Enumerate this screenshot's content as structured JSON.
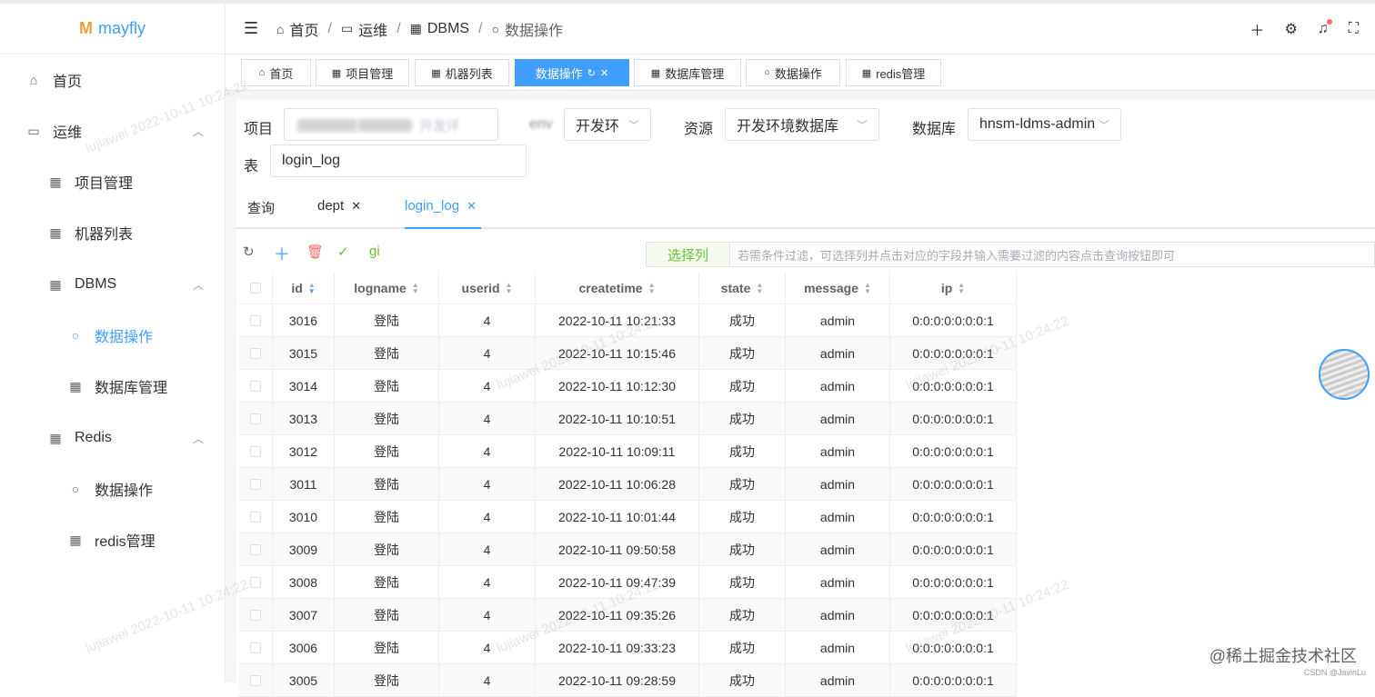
{
  "app": {
    "logo": "mayfly"
  },
  "sidebar": {
    "items": [
      {
        "label": "首页",
        "icon": "home-icon"
      },
      {
        "label": "运维",
        "icon": "monitor-icon"
      },
      {
        "label": "项目管理",
        "icon": "grid-icon"
      },
      {
        "label": "机器列表",
        "icon": "grid-icon"
      },
      {
        "label": "DBMS",
        "icon": "grid-icon"
      },
      {
        "label": "数据操作",
        "icon": "search-icon"
      },
      {
        "label": "数据库管理",
        "icon": "grid-icon"
      },
      {
        "label": "Redis",
        "icon": "grid-icon"
      },
      {
        "label": "数据操作",
        "icon": "search-icon"
      },
      {
        "label": "redis管理",
        "icon": "grid-icon"
      }
    ]
  },
  "header": {
    "breadcrumbs": [
      "首页",
      "运维",
      "DBMS",
      "数据操作"
    ]
  },
  "tags": [
    "首页",
    "项目管理",
    "机器列表",
    "数据操作",
    "数据库管理",
    "数据操作",
    "redis管理"
  ],
  "form": {
    "project_label": "项目",
    "project_value_tail": "开发环",
    "env_label": "env",
    "env_value": "开发环",
    "resource_label": "资源",
    "resource_value": "开发环境数据库",
    "db_label": "数据库",
    "db_value": "hnsm-ldms-admin",
    "table_label": "表",
    "table_value": "login_log"
  },
  "query_tabs": [
    {
      "label": "查询"
    },
    {
      "label": "dept"
    },
    {
      "label": "login_log"
    }
  ],
  "toolbar": {
    "gi_label": "gi",
    "select_columns": "选择列",
    "filter_placeholder": "若需条件过滤，可选择列并点击对应的字段并输入需要过滤的内容点击查询按钮即可"
  },
  "table": {
    "columns": [
      "id",
      "logname",
      "userid",
      "createtime",
      "state",
      "message",
      "ip"
    ],
    "rows": [
      [
        "3016",
        "登陆",
        "4",
        "2022-10-11 10:21:33",
        "成功",
        "admin",
        "0:0:0:0:0:0:0:1"
      ],
      [
        "3015",
        "登陆",
        "4",
        "2022-10-11 10:15:46",
        "成功",
        "admin",
        "0:0:0:0:0:0:0:1"
      ],
      [
        "3014",
        "登陆",
        "4",
        "2022-10-11 10:12:30",
        "成功",
        "admin",
        "0:0:0:0:0:0:0:1"
      ],
      [
        "3013",
        "登陆",
        "4",
        "2022-10-11 10:10:51",
        "成功",
        "admin",
        "0:0:0:0:0:0:0:1"
      ],
      [
        "3012",
        "登陆",
        "4",
        "2022-10-11 10:09:11",
        "成功",
        "admin",
        "0:0:0:0:0:0:0:1"
      ],
      [
        "3011",
        "登陆",
        "4",
        "2022-10-11 10:06:28",
        "成功",
        "admin",
        "0:0:0:0:0:0:0:1"
      ],
      [
        "3010",
        "登陆",
        "4",
        "2022-10-11 10:01:44",
        "成功",
        "admin",
        "0:0:0:0:0:0:0:1"
      ],
      [
        "3009",
        "登陆",
        "4",
        "2022-10-11 09:50:58",
        "成功",
        "admin",
        "0:0:0:0:0:0:0:1"
      ],
      [
        "3008",
        "登陆",
        "4",
        "2022-10-11 09:47:39",
        "成功",
        "admin",
        "0:0:0:0:0:0:0:1"
      ],
      [
        "3007",
        "登陆",
        "4",
        "2022-10-11 09:35:26",
        "成功",
        "admin",
        "0:0:0:0:0:0:0:1"
      ],
      [
        "3006",
        "登陆",
        "4",
        "2022-10-11 09:33:23",
        "成功",
        "admin",
        "0:0:0:0:0:0:0:1"
      ],
      [
        "3005",
        "登陆",
        "4",
        "2022-10-11 09:28:59",
        "成功",
        "admin",
        "0:0:0:0:0:0:0:1"
      ]
    ]
  },
  "watermark": "lujiawei 2022-10-11 10:24:22",
  "footer": {
    "brand": "@稀土掘金技术社区",
    "csdn": "CSDN @JavinLu"
  },
  "colors": {
    "accent": "#409eff",
    "success": "#67c23a",
    "danger": "#f56c6c"
  }
}
